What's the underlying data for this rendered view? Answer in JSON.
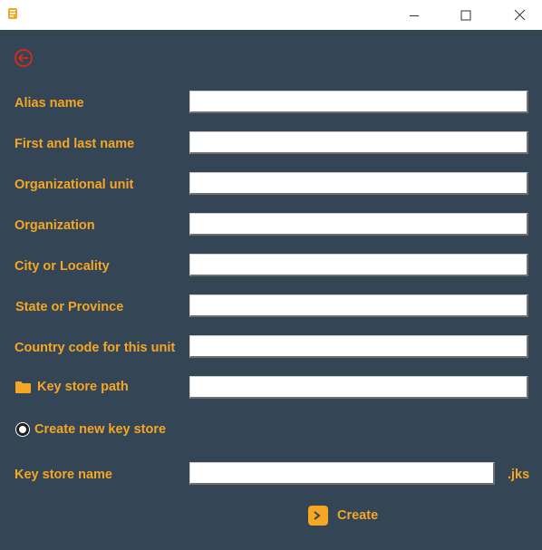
{
  "window": {
    "app_icon": "scroll-icon",
    "controls": [
      "minimize-icon",
      "maximize-icon",
      "close-icon"
    ]
  },
  "back_icon": "arrow-left-circle-icon",
  "form": {
    "alias_name": {
      "label": "Alias name",
      "value": ""
    },
    "first_last_name": {
      "label": "First and last name",
      "value": ""
    },
    "organizational_unit": {
      "label": "Organizational unit",
      "value": ""
    },
    "organization": {
      "label": "Organization",
      "value": ""
    },
    "city_locality": {
      "label": "City or Locality",
      "value": ""
    },
    "state_province": {
      "label": "State or Province",
      "value": ""
    },
    "country_code": {
      "label": "Country code for this unit",
      "value": ""
    },
    "key_store_path": {
      "label": "Key store path",
      "icon": "folder-icon",
      "value": ""
    },
    "create_new_key_store": {
      "label": "Create new key store",
      "selected": true
    },
    "key_store_name": {
      "label": "Key store name",
      "value": "",
      "suffix": ".jks"
    }
  },
  "create_button": {
    "label": "Create",
    "icon": "terminal-prompt-icon"
  },
  "colors": {
    "background": "#344656",
    "accent": "#f5a623",
    "back_icon": "#e0261b"
  }
}
